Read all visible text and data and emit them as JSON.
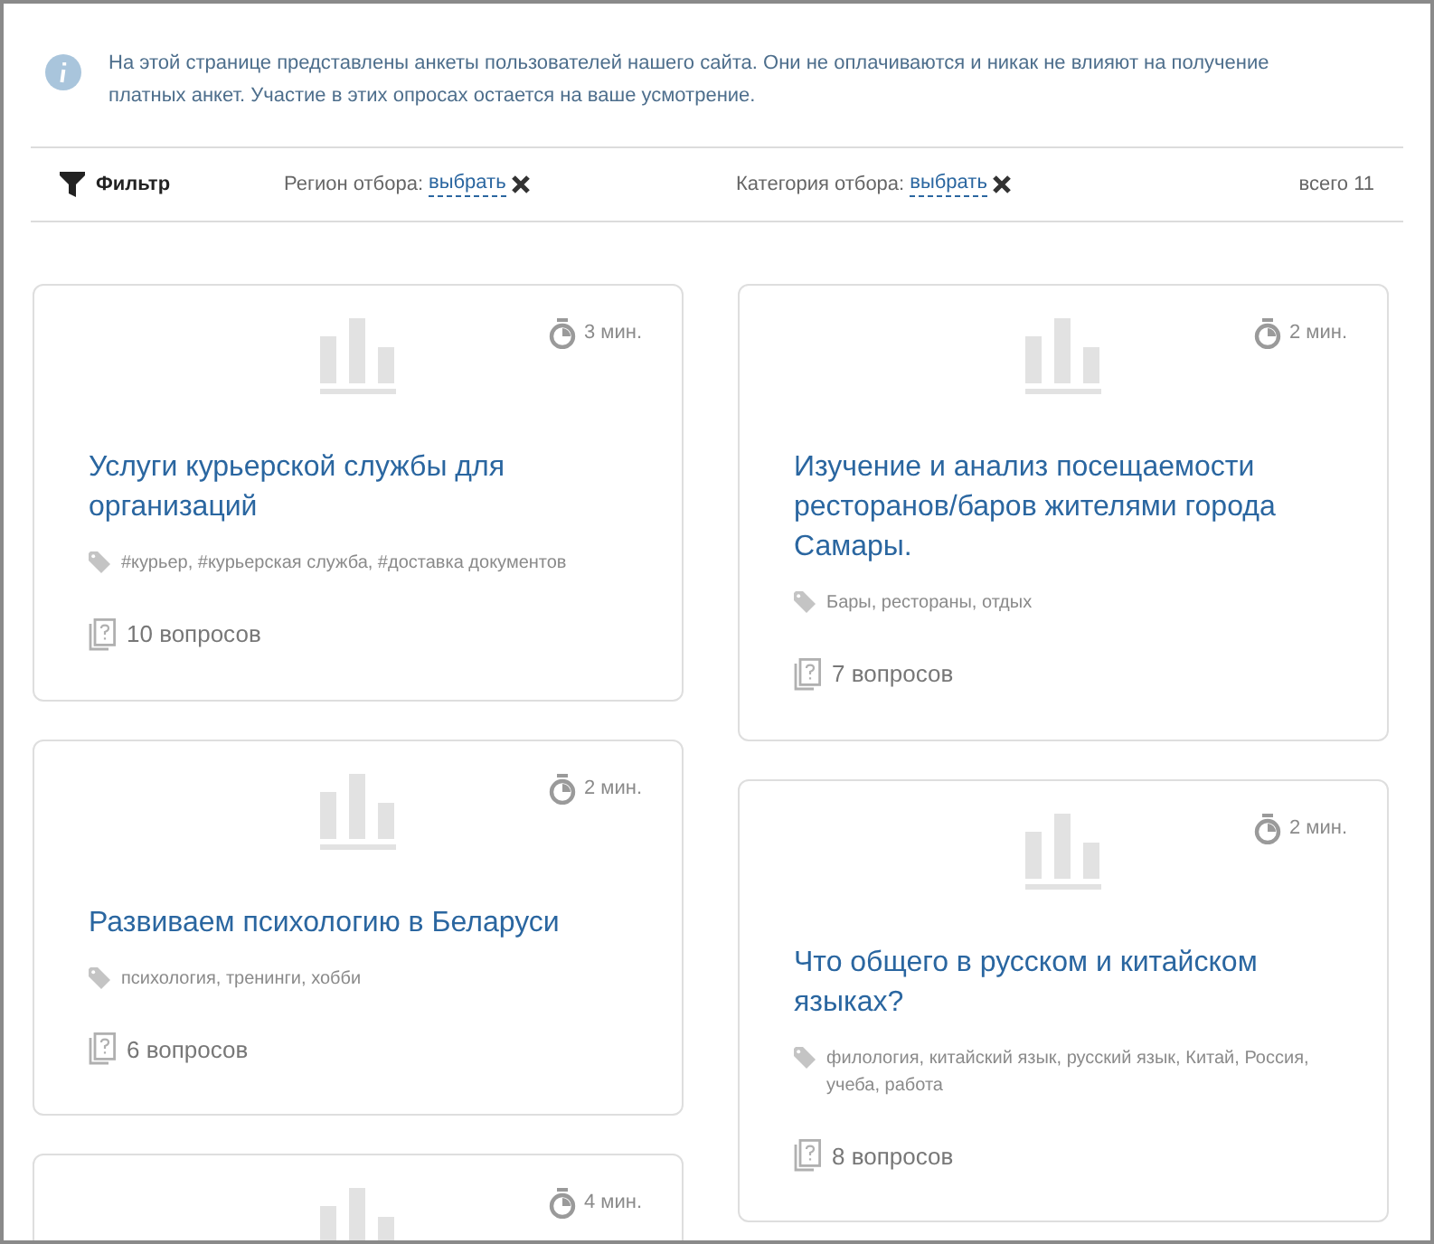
{
  "info": {
    "text": "На этой странице представлены анкеты пользователей нашего сайта. Они не оплачиваются и никак не влияют на получение платных анкет. Участие в этих опросах остается на ваше усмотрение."
  },
  "filter_bar": {
    "title": "Фильтр",
    "region": {
      "label": "Регион отбора:",
      "link": "выбрать"
    },
    "category": {
      "label": "Категория отбора:",
      "link": "выбрать"
    },
    "total": "всего 11"
  },
  "columns": [
    {
      "cards": [
        {
          "duration": "3 мин.",
          "title": "Услуги курьерской службы для организаций",
          "tags": "#курьер, #курьерская служба, #доставка документов",
          "questions": "10 вопросов"
        },
        {
          "duration": "2 мин.",
          "title": "Развиваем психологию в Беларуси",
          "tags": "психология, тренинги, хобби",
          "questions": "6 вопросов"
        },
        {
          "duration": "4 мин."
        }
      ]
    },
    {
      "cards": [
        {
          "duration": "2 мин.",
          "title": "Изучение и анализ посещаемости ресторанов/баров жителями города Самары.",
          "tags": "Бары, рестораны, отдых",
          "questions": "7 вопросов"
        },
        {
          "duration": "2 мин.",
          "title": "Что общего в русском и китайском языках?",
          "tags": "филология, китайский язык, русский язык, Китай, Россия, учеба, работа",
          "questions": "8 вопросов"
        }
      ]
    }
  ]
}
